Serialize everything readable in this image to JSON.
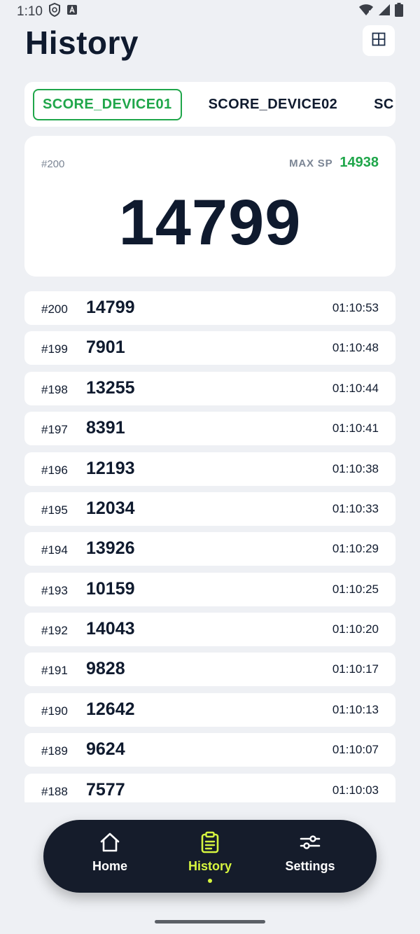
{
  "status_bar": {
    "time": "1:10",
    "icons": [
      "shield-icon",
      "font-a-icon",
      "wifi-icon",
      "signal-icon",
      "battery-icon"
    ]
  },
  "header": {
    "title": "History",
    "grid_button_icon": "grid-icon"
  },
  "tabs": [
    {
      "label": "SCORE_DEVICE01",
      "active": true
    },
    {
      "label": "SCORE_DEVICE02",
      "active": false
    },
    {
      "label": "SC",
      "active": false
    }
  ],
  "summary": {
    "id": "#200",
    "max_label": "MAX SP",
    "max_value": "14938",
    "score": "14799"
  },
  "history": [
    {
      "id": "#200",
      "score": "14799",
      "time": "01:10:53"
    },
    {
      "id": "#199",
      "score": "7901",
      "time": "01:10:48"
    },
    {
      "id": "#198",
      "score": "13255",
      "time": "01:10:44"
    },
    {
      "id": "#197",
      "score": "8391",
      "time": "01:10:41"
    },
    {
      "id": "#196",
      "score": "12193",
      "time": "01:10:38"
    },
    {
      "id": "#195",
      "score": "12034",
      "time": "01:10:33"
    },
    {
      "id": "#194",
      "score": "13926",
      "time": "01:10:29"
    },
    {
      "id": "#193",
      "score": "10159",
      "time": "01:10:25"
    },
    {
      "id": "#192",
      "score": "14043",
      "time": "01:10:20"
    },
    {
      "id": "#191",
      "score": "9828",
      "time": "01:10:17"
    },
    {
      "id": "#190",
      "score": "12642",
      "time": "01:10:13"
    },
    {
      "id": "#189",
      "score": "9624",
      "time": "01:10:07"
    },
    {
      "id": "#188",
      "score": "7577",
      "time": "01:10:03"
    }
  ],
  "nav": {
    "items": [
      {
        "label": "Home",
        "icon": "home-icon",
        "active": false
      },
      {
        "label": "History",
        "icon": "clipboard-icon",
        "active": true
      },
      {
        "label": "Settings",
        "icon": "sliders-icon",
        "active": false
      }
    ]
  },
  "colors": {
    "accent_green": "#1fa64a",
    "nav_active": "#d6f53f",
    "nav_background": "#151c2b",
    "background": "#eef0f4"
  }
}
